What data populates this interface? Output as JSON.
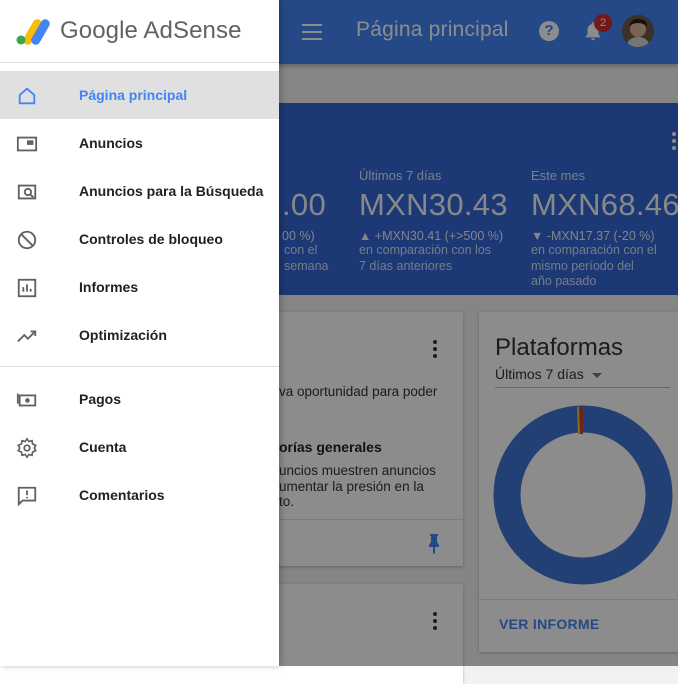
{
  "app": {
    "brand": "Google AdSense",
    "page_title": "Página principal",
    "notification_count": "2"
  },
  "drawer": {
    "items": [
      {
        "label": "Página principal",
        "icon": "home-icon",
        "active": true
      },
      {
        "label": "Anuncios",
        "icon": "ads-icon"
      },
      {
        "label": "Anuncios para la Búsqueda",
        "icon": "search-ads-icon"
      },
      {
        "label": "Controles de bloqueo",
        "icon": "block-icon"
      },
      {
        "label": "Informes",
        "icon": "reports-icon"
      },
      {
        "label": "Optimización",
        "icon": "trending-icon"
      },
      {
        "label": "Pagos",
        "icon": "payments-icon"
      },
      {
        "label": "Cuenta",
        "icon": "gear-icon"
      },
      {
        "label": "Comentarios",
        "icon": "feedback-icon"
      }
    ]
  },
  "summary": {
    "partial_value": ".00",
    "partial_delta": "00 %)",
    "partial_note1": "con el",
    "partial_note2": "semana",
    "stats": [
      {
        "label": "Últimos 7 días",
        "value": "MXN30.43",
        "delta": "▲ +MXN30.41 (+>500 %)",
        "note": [
          "en comparación con los",
          "7 días anteriores"
        ]
      },
      {
        "label": "Este mes",
        "value": "MXN68.46",
        "delta": "▼ -MXN17.37 (-20 %)",
        "note": [
          "en comparación con el",
          "mismo período del",
          "año pasado"
        ]
      }
    ]
  },
  "opportunity_card": {
    "line1": "va oportunidad para poder",
    "heading": "orías generales",
    "body": [
      "uncios muestren anuncios",
      "umentar la presión en la",
      "to."
    ]
  },
  "platforms_card": {
    "title": "Plataformas",
    "range": "Últimos 7 días",
    "link": "VER INFORME"
  },
  "colors": {
    "primary": "#4285f4",
    "summary_bg": "#3367d6",
    "badge": "#d32f2f"
  }
}
